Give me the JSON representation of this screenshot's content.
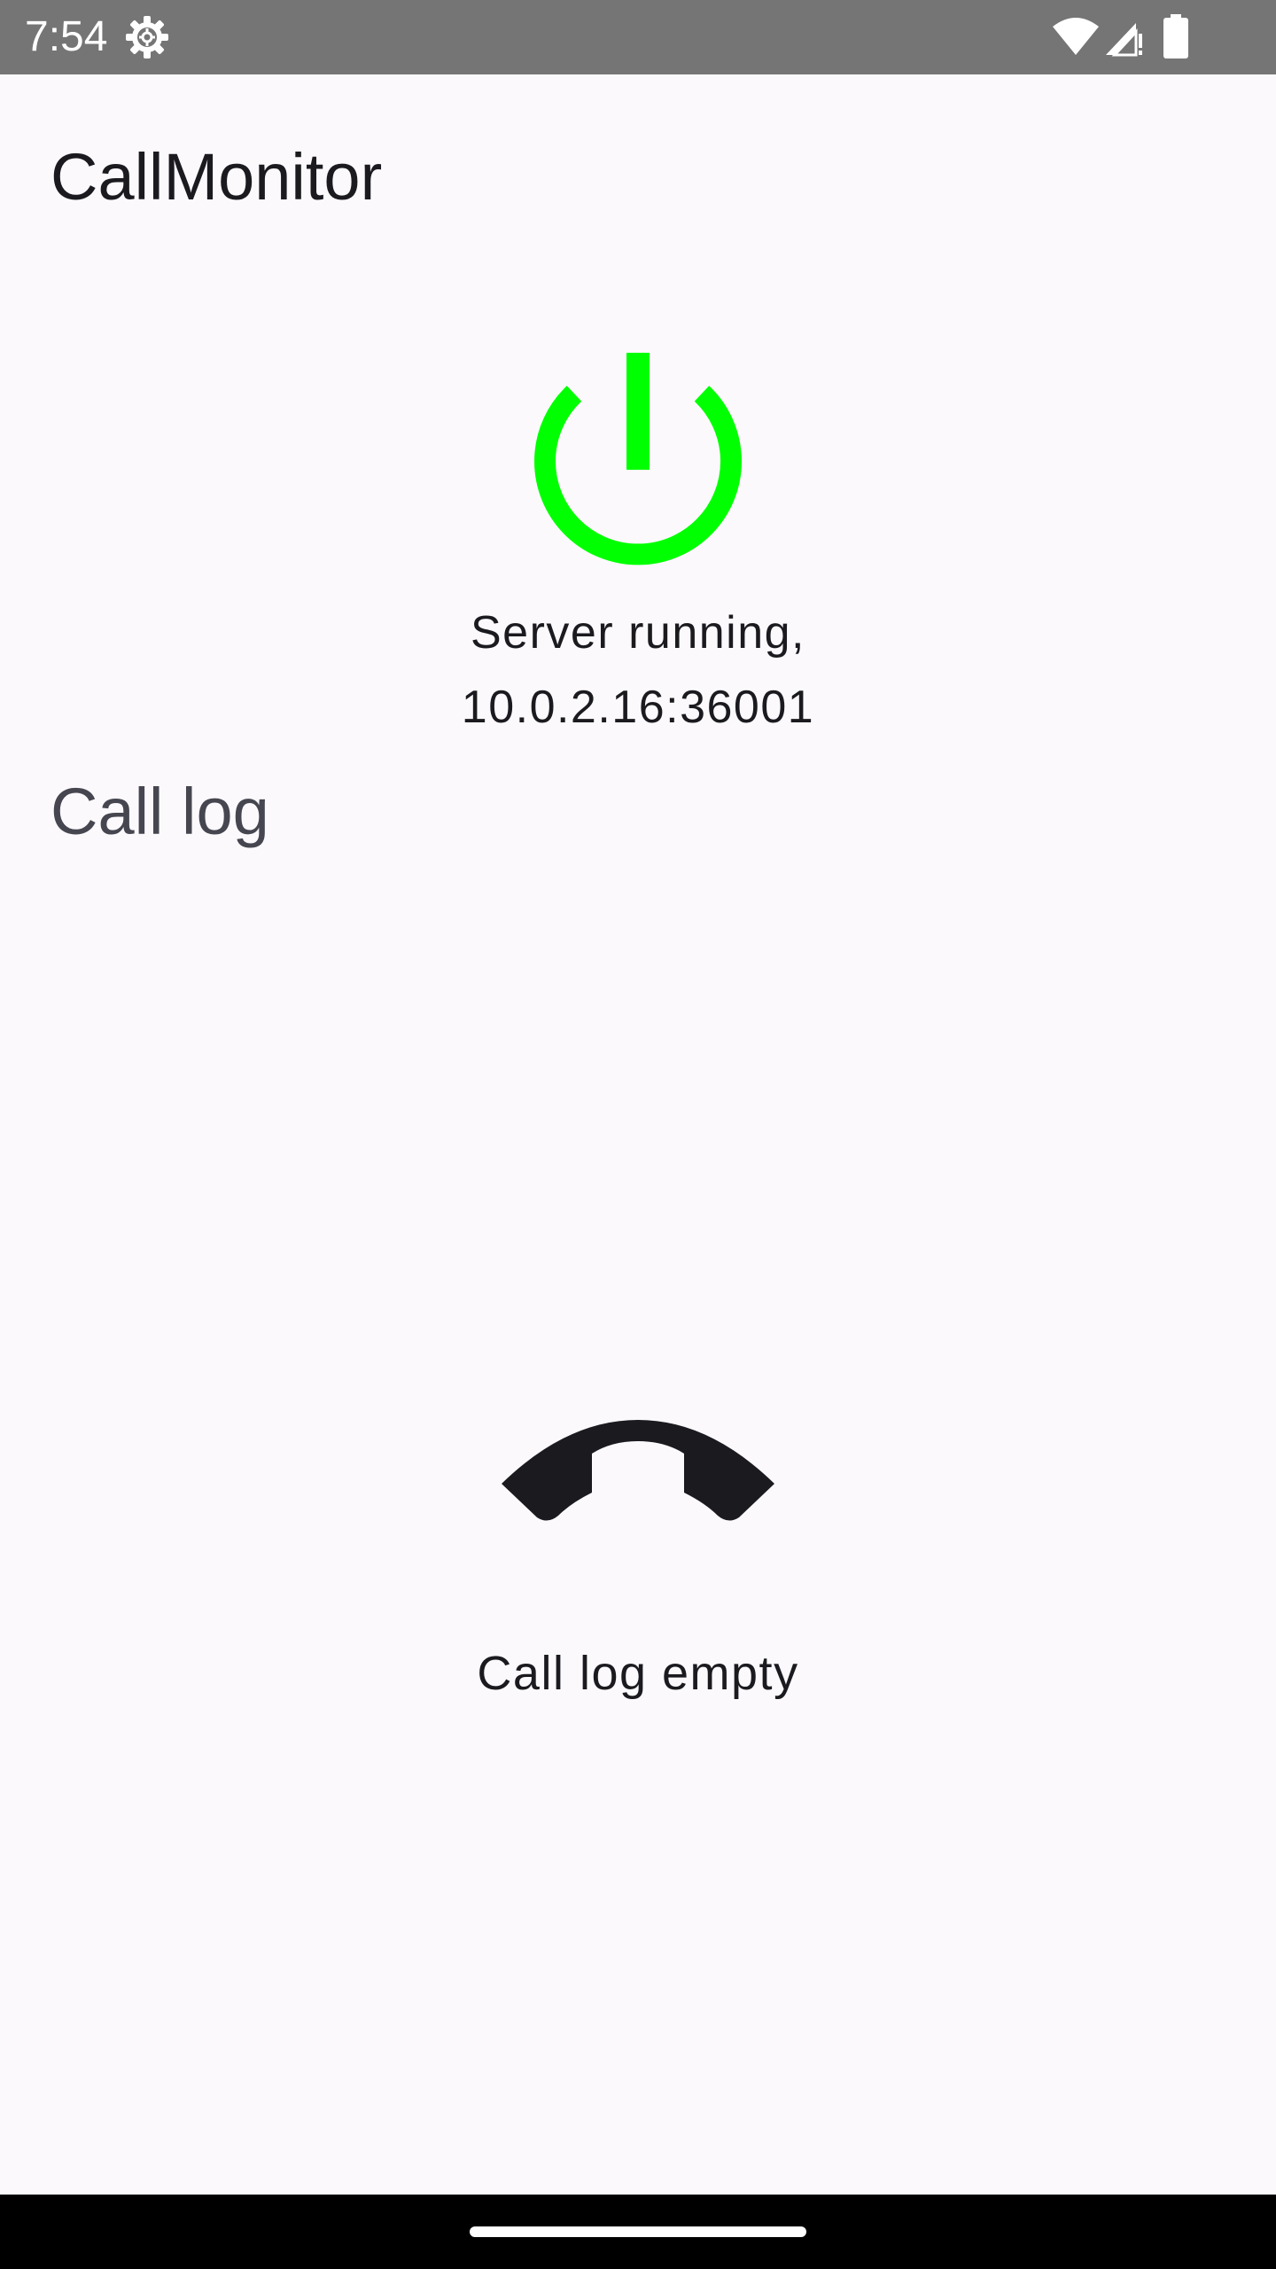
{
  "status_bar": {
    "time": "7:54",
    "icons": [
      "settings-gear-icon",
      "wifi-icon",
      "cell-signal-icon",
      "battery-icon"
    ]
  },
  "app": {
    "title": "CallMonitor"
  },
  "server": {
    "state": "running",
    "power_icon": "power-icon",
    "power_color": "#00ff00",
    "status_line1": "Server running,",
    "status_line2": "10.0.2.16:36001"
  },
  "call_log": {
    "section_title": "Call log",
    "empty_icon": "call-end-icon",
    "empty_text": "Call log empty"
  },
  "colors": {
    "background": "#fcf9fd",
    "status_bar": "#757575",
    "text_primary": "#1b1b1f",
    "text_secondary": "#45464f",
    "accent_power": "#00ff00"
  }
}
